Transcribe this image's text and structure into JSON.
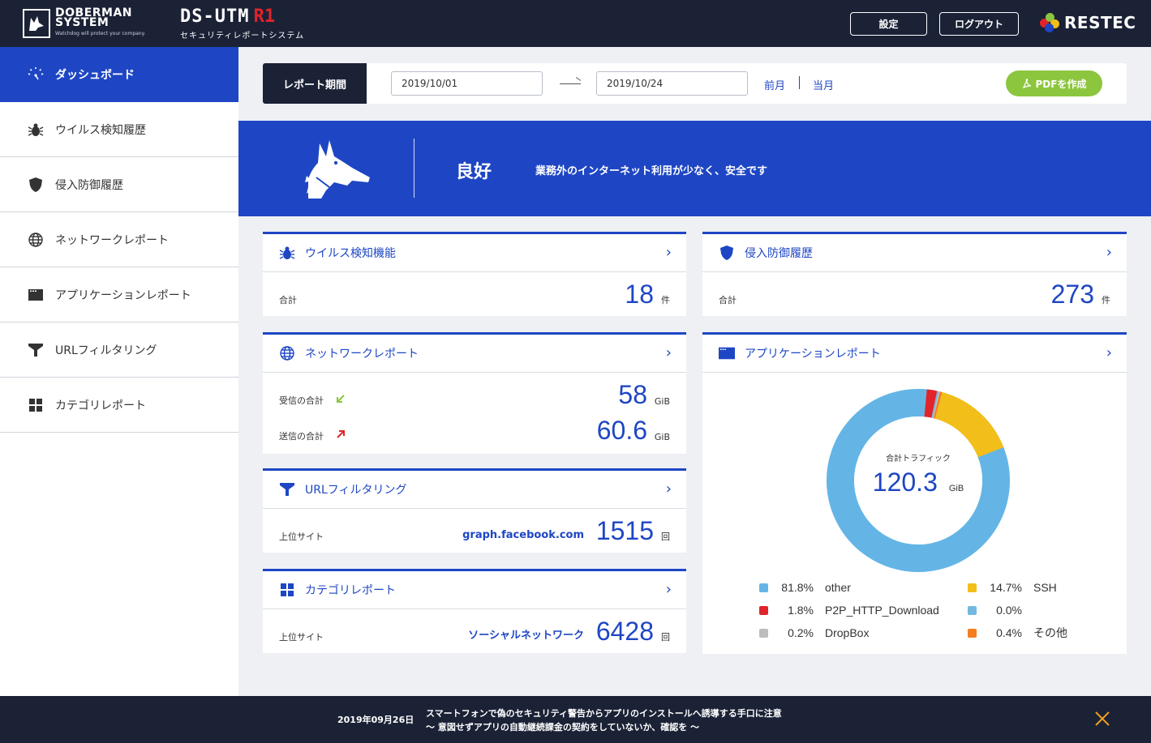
{
  "header": {
    "brand_line1": "DOBERMAN",
    "brand_line2": "SYSTEM",
    "brand_tagline": "Watchdog will protect your company.",
    "product_name": "DS-UTM",
    "product_version": "R1",
    "product_subtitle": "セキュリティレポートシステム",
    "settings_label": "設定",
    "logout_label": "ログアウト",
    "vendor_name": "RESTEC"
  },
  "sidebar": {
    "items": [
      {
        "label": "ダッシュボード",
        "icon": "dashboard-icon",
        "active": true
      },
      {
        "label": "ウイルス検知履歴",
        "icon": "bug-icon"
      },
      {
        "label": "侵入防御履歴",
        "icon": "shield-icon"
      },
      {
        "label": "ネットワークレポート",
        "icon": "globe-icon"
      },
      {
        "label": "アプリケーションレポート",
        "icon": "app-window-icon"
      },
      {
        "label": "URLフィルタリング",
        "icon": "filter-icon"
      },
      {
        "label": "カテゴリレポート",
        "icon": "grid-icon"
      }
    ]
  },
  "period": {
    "label": "レポート期間",
    "from": "2019/10/01",
    "to": "2019/10/24",
    "prev_label": "前月",
    "current_label": "当月",
    "pdf_label": "PDFを作成"
  },
  "status": {
    "title": "良好",
    "message": "業務外のインターネット利用が少なく、安全です"
  },
  "cards": {
    "virus": {
      "title": "ウイルス検知機能",
      "row_label": "合計",
      "value": "18",
      "unit": "件"
    },
    "ips": {
      "title": "侵入防御履歴",
      "row_label": "合計",
      "value": "273",
      "unit": "件"
    },
    "network": {
      "title": "ネットワークレポート",
      "recv_label": "受信の合計",
      "recv_value": "58",
      "recv_unit": "GiB",
      "send_label": "送信の合計",
      "send_value": "60.6",
      "send_unit": "GiB"
    },
    "url": {
      "title": "URLフィルタリング",
      "row_label": "上位サイト",
      "site": "graph.facebook.com",
      "value": "1515",
      "unit": "回"
    },
    "category": {
      "title": "カテゴリレポート",
      "row_label": "上位サイト",
      "site": "ソーシャルネットワーク",
      "value": "6428",
      "unit": "回"
    },
    "app": {
      "title": "アプリケーションレポート",
      "center_label": "合計トラフィック",
      "center_value": "120.3",
      "center_unit": "GiB"
    }
  },
  "chart_data": {
    "type": "pie",
    "categories": [
      "other",
      "SSH",
      "P2P_HTTP_Download",
      "",
      "DropBox",
      "その他"
    ],
    "values": [
      81.8,
      14.7,
      1.8,
      0.0,
      0.2,
      0.4
    ],
    "labels": [
      "81.8%",
      "14.7%",
      "1.8%",
      "0.0%",
      "0.2%",
      "0.4%"
    ],
    "colors": [
      "#64b5e6",
      "#f2be1a",
      "#e0242a",
      "#74b8e2",
      "#bdbdbd",
      "#f47f20"
    ],
    "order": [
      "other",
      "P2P_HTTP_Download",
      "",
      "DropBox",
      "その他",
      "SSH"
    ],
    "legend_names": [
      "other",
      "SSH",
      "P2P_HTTP_Download",
      "",
      "DropBox",
      "その他"
    ]
  },
  "footer": {
    "news_date": "2019年09月26日",
    "news_line1": "スマートフォンで偽のセキュリティ警告からアプリのインストールへ誘導する手口に注意",
    "news_line2": "～ 意図せずアプリの自動継続課金の契約をしていないか、確認を ～"
  },
  "colors": {
    "brand_blue": "#1e46c4",
    "navy": "#1b2236",
    "pdf_green": "#8cc63e",
    "close_orange": "#f0a020"
  }
}
